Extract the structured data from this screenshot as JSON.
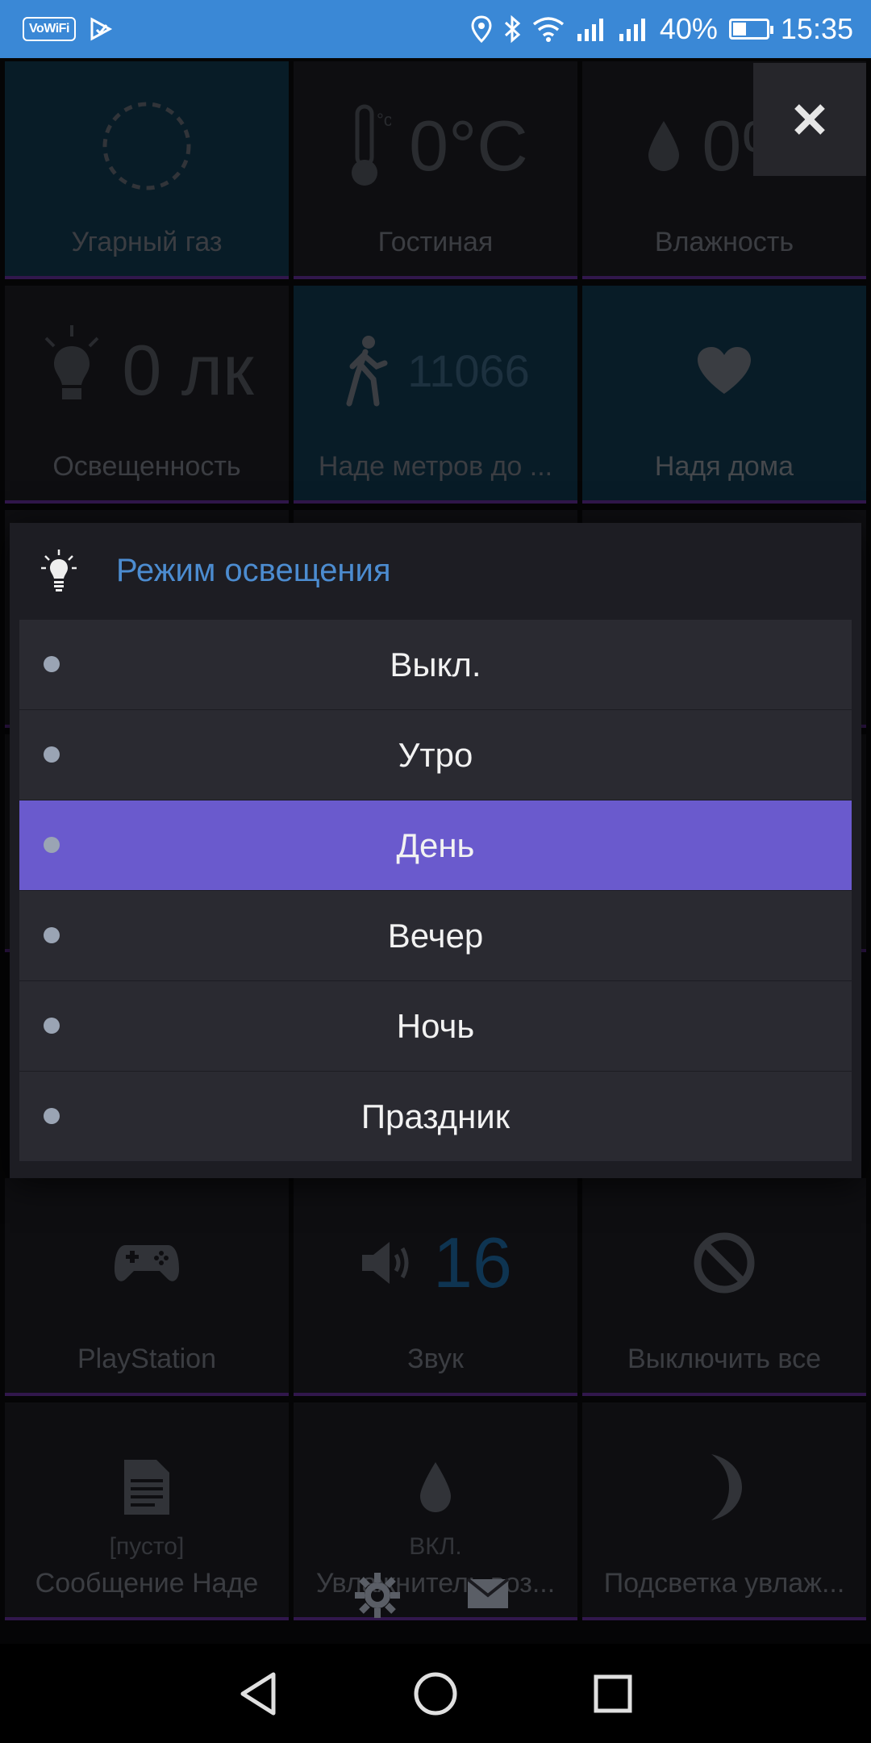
{
  "status_bar": {
    "vowifi": "VoWiFi",
    "battery_percent": "40%",
    "battery_level": 0.4,
    "time": "15:35"
  },
  "tiles": [
    {
      "id": "co",
      "label": "Угарный газ",
      "value": "",
      "icon": "smoke-ring-icon"
    },
    {
      "id": "living",
      "label": "Гостиная",
      "value": "0°C",
      "icon": "thermometer-icon"
    },
    {
      "id": "humidity",
      "label": "Влажность",
      "value": "0%",
      "icon": "water-drop-icon"
    },
    {
      "id": "illuminance",
      "label": "Освещенность",
      "value": "0 лк",
      "icon": "bulb-icon"
    },
    {
      "id": "nadya-distance",
      "label": "Наде метров до ...",
      "value": "11066",
      "icon": "walking-icon"
    },
    {
      "id": "nadya-home",
      "label": "Надя дома",
      "value": "",
      "icon": "heart-icon"
    },
    {
      "id": "playstation",
      "label": "PlayStation",
      "value": "",
      "icon": "gamepad-icon"
    },
    {
      "id": "sound",
      "label": "Звук",
      "value": "16",
      "icon": "speaker-icon"
    },
    {
      "id": "all-off",
      "label": "Выключить все",
      "value": "",
      "icon": "block-icon"
    },
    {
      "id": "message",
      "label": "Сообщение Наде",
      "sub": "[пусто]",
      "icon": "document-icon"
    },
    {
      "id": "humidifier",
      "label": "Увлажнитель воз...",
      "sub": "ВКЛ.",
      "icon": "water-drop-icon"
    },
    {
      "id": "humidifier-light",
      "label": "Подсветка увлаж...",
      "icon": "moon-icon"
    }
  ],
  "dialog": {
    "title": "Режим освещения",
    "icon": "bulb-icon",
    "selected": "День",
    "options": [
      "Выкл.",
      "Утро",
      "День",
      "Вечер",
      "Ночь",
      "Праздник"
    ]
  },
  "colors": {
    "statusbar": "#3a88d6",
    "accent_title": "#4c8cd0",
    "selected_option": "#6a5acd",
    "option_bg": "#2a2a31"
  }
}
